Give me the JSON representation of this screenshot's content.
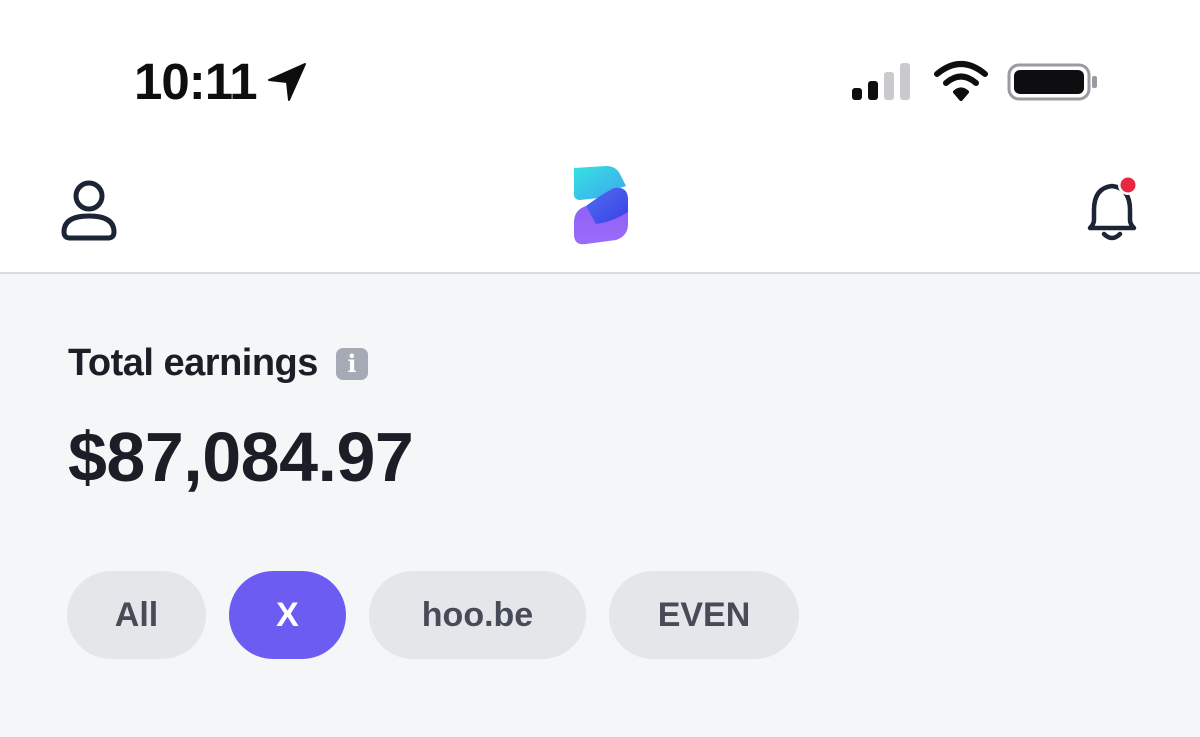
{
  "status_bar": {
    "time": "10:11",
    "location_icon": "location-arrow-icon",
    "signal_icon": "cellular-signal-icon",
    "wifi_icon": "wifi-icon",
    "battery_icon": "battery-icon",
    "signal_bars_filled": 2,
    "signal_bars_total": 4
  },
  "header": {
    "profile_icon": "profile-icon",
    "logo": "app-logo",
    "notifications_icon": "bell-icon",
    "has_unread_notification": true,
    "notification_dot_color": "#e8283e"
  },
  "earnings": {
    "label": "Total earnings",
    "info_icon_glyph": "i",
    "amount": "$87,084.97"
  },
  "filters": {
    "active_color": "#6c5cf2",
    "items": [
      {
        "label": "All",
        "active": false
      },
      {
        "label": "X",
        "active": true
      },
      {
        "label": "hoo.be",
        "active": false
      },
      {
        "label": "EVEN",
        "active": false
      }
    ]
  }
}
